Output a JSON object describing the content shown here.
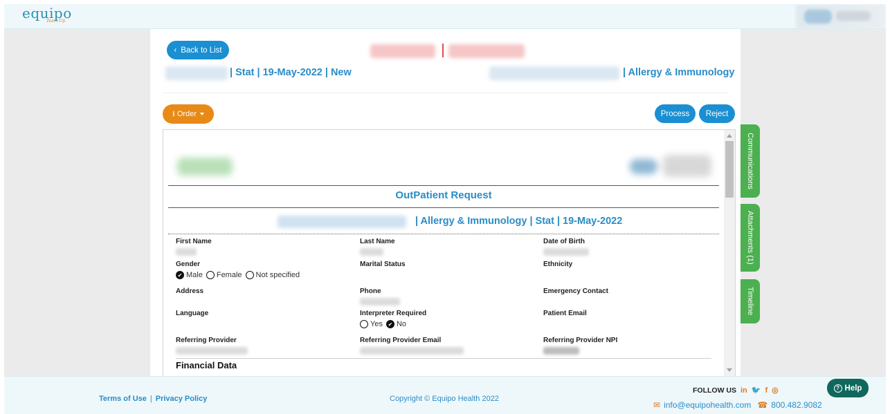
{
  "brand": {
    "logo": "equipo",
    "tagline": "Team Up"
  },
  "header": {
    "back_label": "Back to List",
    "left_meta": "| Stat  | 19-May-2022 | New",
    "right_meta": "| Allergy & Immunology"
  },
  "toolbar": {
    "order_label": "Order",
    "process_label": "Process",
    "reject_label": "Reject"
  },
  "document": {
    "title": "OutPatient Request",
    "subtitle": "| Allergy & Immunology | Stat | 19-May-2022",
    "fields": {
      "first_name": "First Name",
      "last_name": "Last Name",
      "dob": "Date of Birth",
      "gender": "Gender",
      "marital_status": "Marital Status",
      "ethnicity": "Ethnicity",
      "address": "Address",
      "phone": "Phone",
      "emergency_contact": "Emergency Contact",
      "language": "Language",
      "interpreter_required": "Interpreter Required",
      "patient_email": "Patient Email",
      "referring_provider": "Referring Provider",
      "referring_provider_email": "Referring Provider Email",
      "referring_provider_npi": "Referring Provider NPI"
    },
    "gender_options": [
      "Male",
      "Female",
      "Not specified"
    ],
    "gender_selected": "Male",
    "interpreter_options": [
      "Yes",
      "No"
    ],
    "interpreter_selected": "No",
    "section_financial": "Financial Data"
  },
  "side_tabs": {
    "communications": "Communications",
    "attachments": "Attachments (1)",
    "timeline": "Timeline"
  },
  "footer": {
    "terms": "Terms of Use",
    "privacy": "Privacy Policy",
    "copyright": "Copyright © Equipo Health 2022",
    "follow_us": "FOLLOW US",
    "social": [
      "in",
      "twitter",
      "f",
      "instagram"
    ],
    "email": "info@equipohealth.com",
    "phone": "800.482.9082",
    "help_label": "Help"
  },
  "colors": {
    "primary": "#1a8fd2",
    "accent": "#e88a17",
    "tab_green": "#4caf50",
    "help_green": "#10685c",
    "text_blue": "#2a8cc6"
  }
}
